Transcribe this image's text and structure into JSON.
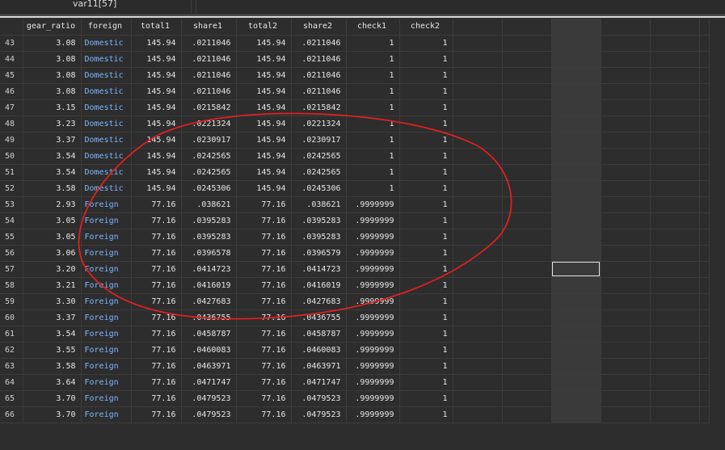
{
  "header": {
    "var_ref": "var11[57]",
    "value": ""
  },
  "columns": [
    "gear_ratio",
    "foreign",
    "total1",
    "share1",
    "total2",
    "share2",
    "check1",
    "check2"
  ],
  "rows": [
    {
      "obs": "43",
      "gear_ratio": "3.08",
      "foreign": "Domestic",
      "total1": "145.94",
      "share1": ".0211046",
      "total2": "145.94",
      "share2": ".0211046",
      "check1": "1",
      "check2": "1"
    },
    {
      "obs": "44",
      "gear_ratio": "3.08",
      "foreign": "Domestic",
      "total1": "145.94",
      "share1": ".0211046",
      "total2": "145.94",
      "share2": ".0211046",
      "check1": "1",
      "check2": "1"
    },
    {
      "obs": "45",
      "gear_ratio": "3.08",
      "foreign": "Domestic",
      "total1": "145.94",
      "share1": ".0211046",
      "total2": "145.94",
      "share2": ".0211046",
      "check1": "1",
      "check2": "1"
    },
    {
      "obs": "46",
      "gear_ratio": "3.08",
      "foreign": "Domestic",
      "total1": "145.94",
      "share1": ".0211046",
      "total2": "145.94",
      "share2": ".0211046",
      "check1": "1",
      "check2": "1"
    },
    {
      "obs": "47",
      "gear_ratio": "3.15",
      "foreign": "Domestic",
      "total1": "145.94",
      "share1": ".0215842",
      "total2": "145.94",
      "share2": ".0215842",
      "check1": "1",
      "check2": "1"
    },
    {
      "obs": "48",
      "gear_ratio": "3.23",
      "foreign": "Domestic",
      "total1": "145.94",
      "share1": ".0221324",
      "total2": "145.94",
      "share2": ".0221324",
      "check1": "1",
      "check2": "1"
    },
    {
      "obs": "49",
      "gear_ratio": "3.37",
      "foreign": "Domestic",
      "total1": "145.94",
      "share1": ".0230917",
      "total2": "145.94",
      "share2": ".0230917",
      "check1": "1",
      "check2": "1"
    },
    {
      "obs": "50",
      "gear_ratio": "3.54",
      "foreign": "Domestic",
      "total1": "145.94",
      "share1": ".0242565",
      "total2": "145.94",
      "share2": ".0242565",
      "check1": "1",
      "check2": "1"
    },
    {
      "obs": "51",
      "gear_ratio": "3.54",
      "foreign": "Domestic",
      "total1": "145.94",
      "share1": ".0242565",
      "total2": "145.94",
      "share2": ".0242565",
      "check1": "1",
      "check2": "1"
    },
    {
      "obs": "52",
      "gear_ratio": "3.58",
      "foreign": "Domestic",
      "total1": "145.94",
      "share1": ".0245306",
      "total2": "145.94",
      "share2": ".0245306",
      "check1": "1",
      "check2": "1"
    },
    {
      "obs": "53",
      "gear_ratio": "2.93",
      "foreign": "Foreign",
      "total1": "77.16",
      "share1": ".038621",
      "total2": "77.16",
      "share2": ".038621",
      "check1": ".9999999",
      "check2": "1"
    },
    {
      "obs": "54",
      "gear_ratio": "3.05",
      "foreign": "Foreign",
      "total1": "77.16",
      "share1": ".0395283",
      "total2": "77.16",
      "share2": ".0395283",
      "check1": ".9999999",
      "check2": "1"
    },
    {
      "obs": "55",
      "gear_ratio": "3.05",
      "foreign": "Foreign",
      "total1": "77.16",
      "share1": ".0395283",
      "total2": "77.16",
      "share2": ".0395283",
      "check1": ".9999999",
      "check2": "1"
    },
    {
      "obs": "56",
      "gear_ratio": "3.06",
      "foreign": "Foreign",
      "total1": "77.16",
      "share1": ".0396578",
      "total2": "77.16",
      "share2": ".0396579",
      "check1": ".9999999",
      "check2": "1"
    },
    {
      "obs": "57",
      "gear_ratio": "3.20",
      "foreign": "Foreign",
      "total1": "77.16",
      "share1": ".0414723",
      "total2": "77.16",
      "share2": ".0414723",
      "check1": ".9999999",
      "check2": "1"
    },
    {
      "obs": "58",
      "gear_ratio": "3.21",
      "foreign": "Foreign",
      "total1": "77.16",
      "share1": ".0416019",
      "total2": "77.16",
      "share2": ".0416019",
      "check1": ".9999999",
      "check2": "1"
    },
    {
      "obs": "59",
      "gear_ratio": "3.30",
      "foreign": "Foreign",
      "total1": "77.16",
      "share1": ".0427683",
      "total2": "77.16",
      "share2": ".0427683",
      "check1": ".9999999",
      "check2": "1"
    },
    {
      "obs": "60",
      "gear_ratio": "3.37",
      "foreign": "Foreign",
      "total1": "77.16",
      "share1": ".0436755",
      "total2": "77.16",
      "share2": ".0436755",
      "check1": ".9999999",
      "check2": "1"
    },
    {
      "obs": "61",
      "gear_ratio": "3.54",
      "foreign": "Foreign",
      "total1": "77.16",
      "share1": ".0458787",
      "total2": "77.16",
      "share2": ".0458787",
      "check1": ".9999999",
      "check2": "1"
    },
    {
      "obs": "62",
      "gear_ratio": "3.55",
      "foreign": "Foreign",
      "total1": "77.16",
      "share1": ".0460083",
      "total2": "77.16",
      "share2": ".0460083",
      "check1": ".9999999",
      "check2": "1"
    },
    {
      "obs": "63",
      "gear_ratio": "3.58",
      "foreign": "Foreign",
      "total1": "77.16",
      "share1": ".0463971",
      "total2": "77.16",
      "share2": ".0463971",
      "check1": ".9999999",
      "check2": "1"
    },
    {
      "obs": "64",
      "gear_ratio": "3.64",
      "foreign": "Foreign",
      "total1": "77.16",
      "share1": ".0471747",
      "total2": "77.16",
      "share2": ".0471747",
      "check1": ".9999999",
      "check2": "1"
    },
    {
      "obs": "65",
      "gear_ratio": "3.70",
      "foreign": "Foreign",
      "total1": "77.16",
      "share1": ".0479523",
      "total2": "77.16",
      "share2": ".0479523",
      "check1": ".9999999",
      "check2": "1"
    },
    {
      "obs": "66",
      "gear_ratio": "3.70",
      "foreign": "Foreign",
      "total1": "77.16",
      "share1": ".0479523",
      "total2": "77.16",
      "share2": ".0479523",
      "check1": ".9999999",
      "check2": "1"
    }
  ],
  "selection": {
    "obs": "57",
    "var": "var11"
  },
  "colors": {
    "background": "#2d2d2d",
    "grid_line": "#3c3c3c",
    "label_blue": "#7cb6ff",
    "annotation_red": "#e02020"
  }
}
